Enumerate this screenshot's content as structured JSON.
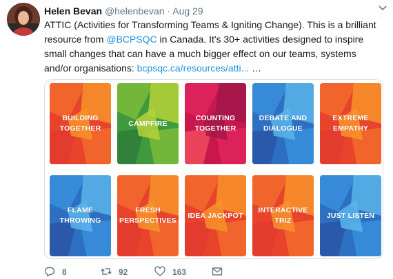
{
  "tweet": {
    "author_name": "Helen Bevan",
    "handle": "@helenbevan",
    "separator": "·",
    "date": "Aug 29",
    "text_before_mention": "ATTIC (Activities for Transforming Teams & Igniting Change). This is a brilliant resource from ",
    "mention": "@BCPSQC",
    "text_after_mention": " in Canada. It's 30+ activities designed to inspire small changes that can have a much bigger effect on our teams, systems and/or organisations: ",
    "link_text": "bcpsqc.ca/resources/atti...",
    "ellipsis": " …"
  },
  "cards": [
    {
      "label": "BUILDING TOGETHER",
      "palette": [
        "#e8432b",
        "#f26a2b",
        "#f7922a",
        "#e23a2f"
      ]
    },
    {
      "label": "CAMPFIRE",
      "palette": [
        "#3f9a3d",
        "#7cbc3a",
        "#b6d23a",
        "#2f7d3b"
      ]
    },
    {
      "label": "COUNTING TOGETHER",
      "palette": [
        "#c8174c",
        "#e0245e",
        "#a3174a",
        "#ef4a5d"
      ]
    },
    {
      "label": "DEBATE AND DIALOGUE",
      "palette": [
        "#2d6fc0",
        "#3a8fdc",
        "#5bb4ea",
        "#2a56a8"
      ]
    },
    {
      "label": "EXTREME EMPATHY",
      "palette": [
        "#e8432b",
        "#f26a2b",
        "#f7922a",
        "#e23a2f"
      ]
    },
    {
      "label": "FLAME THROWING",
      "palette": [
        "#2d6fc0",
        "#3a8fdc",
        "#5bb4ea",
        "#2a56a8"
      ]
    },
    {
      "label": "FRESH PERSPECTIVES",
      "palette": [
        "#e8432b",
        "#f26a2b",
        "#f7922a",
        "#e23a2f"
      ]
    },
    {
      "label": "IDEA JACKPOT",
      "palette": [
        "#e8432b",
        "#f26a2b",
        "#f7922a",
        "#e23a2f"
      ]
    },
    {
      "label": "INTERACTIVE TRIZ",
      "palette": [
        "#e8432b",
        "#f26a2b",
        "#f7922a",
        "#e23a2f"
      ]
    },
    {
      "label": "JUST LISTEN",
      "palette": [
        "#2d6fc0",
        "#3a8fdc",
        "#5bb4ea",
        "#2a56a8"
      ]
    }
  ],
  "actions": {
    "reply_count": "8",
    "retweet_count": "92",
    "like_count": "163",
    "icons": [
      "reply-icon",
      "retweet-icon",
      "like-icon",
      "message-icon"
    ]
  },
  "colors": {
    "link": "#1b95e0",
    "muted": "#657786",
    "text": "#14171a"
  }
}
